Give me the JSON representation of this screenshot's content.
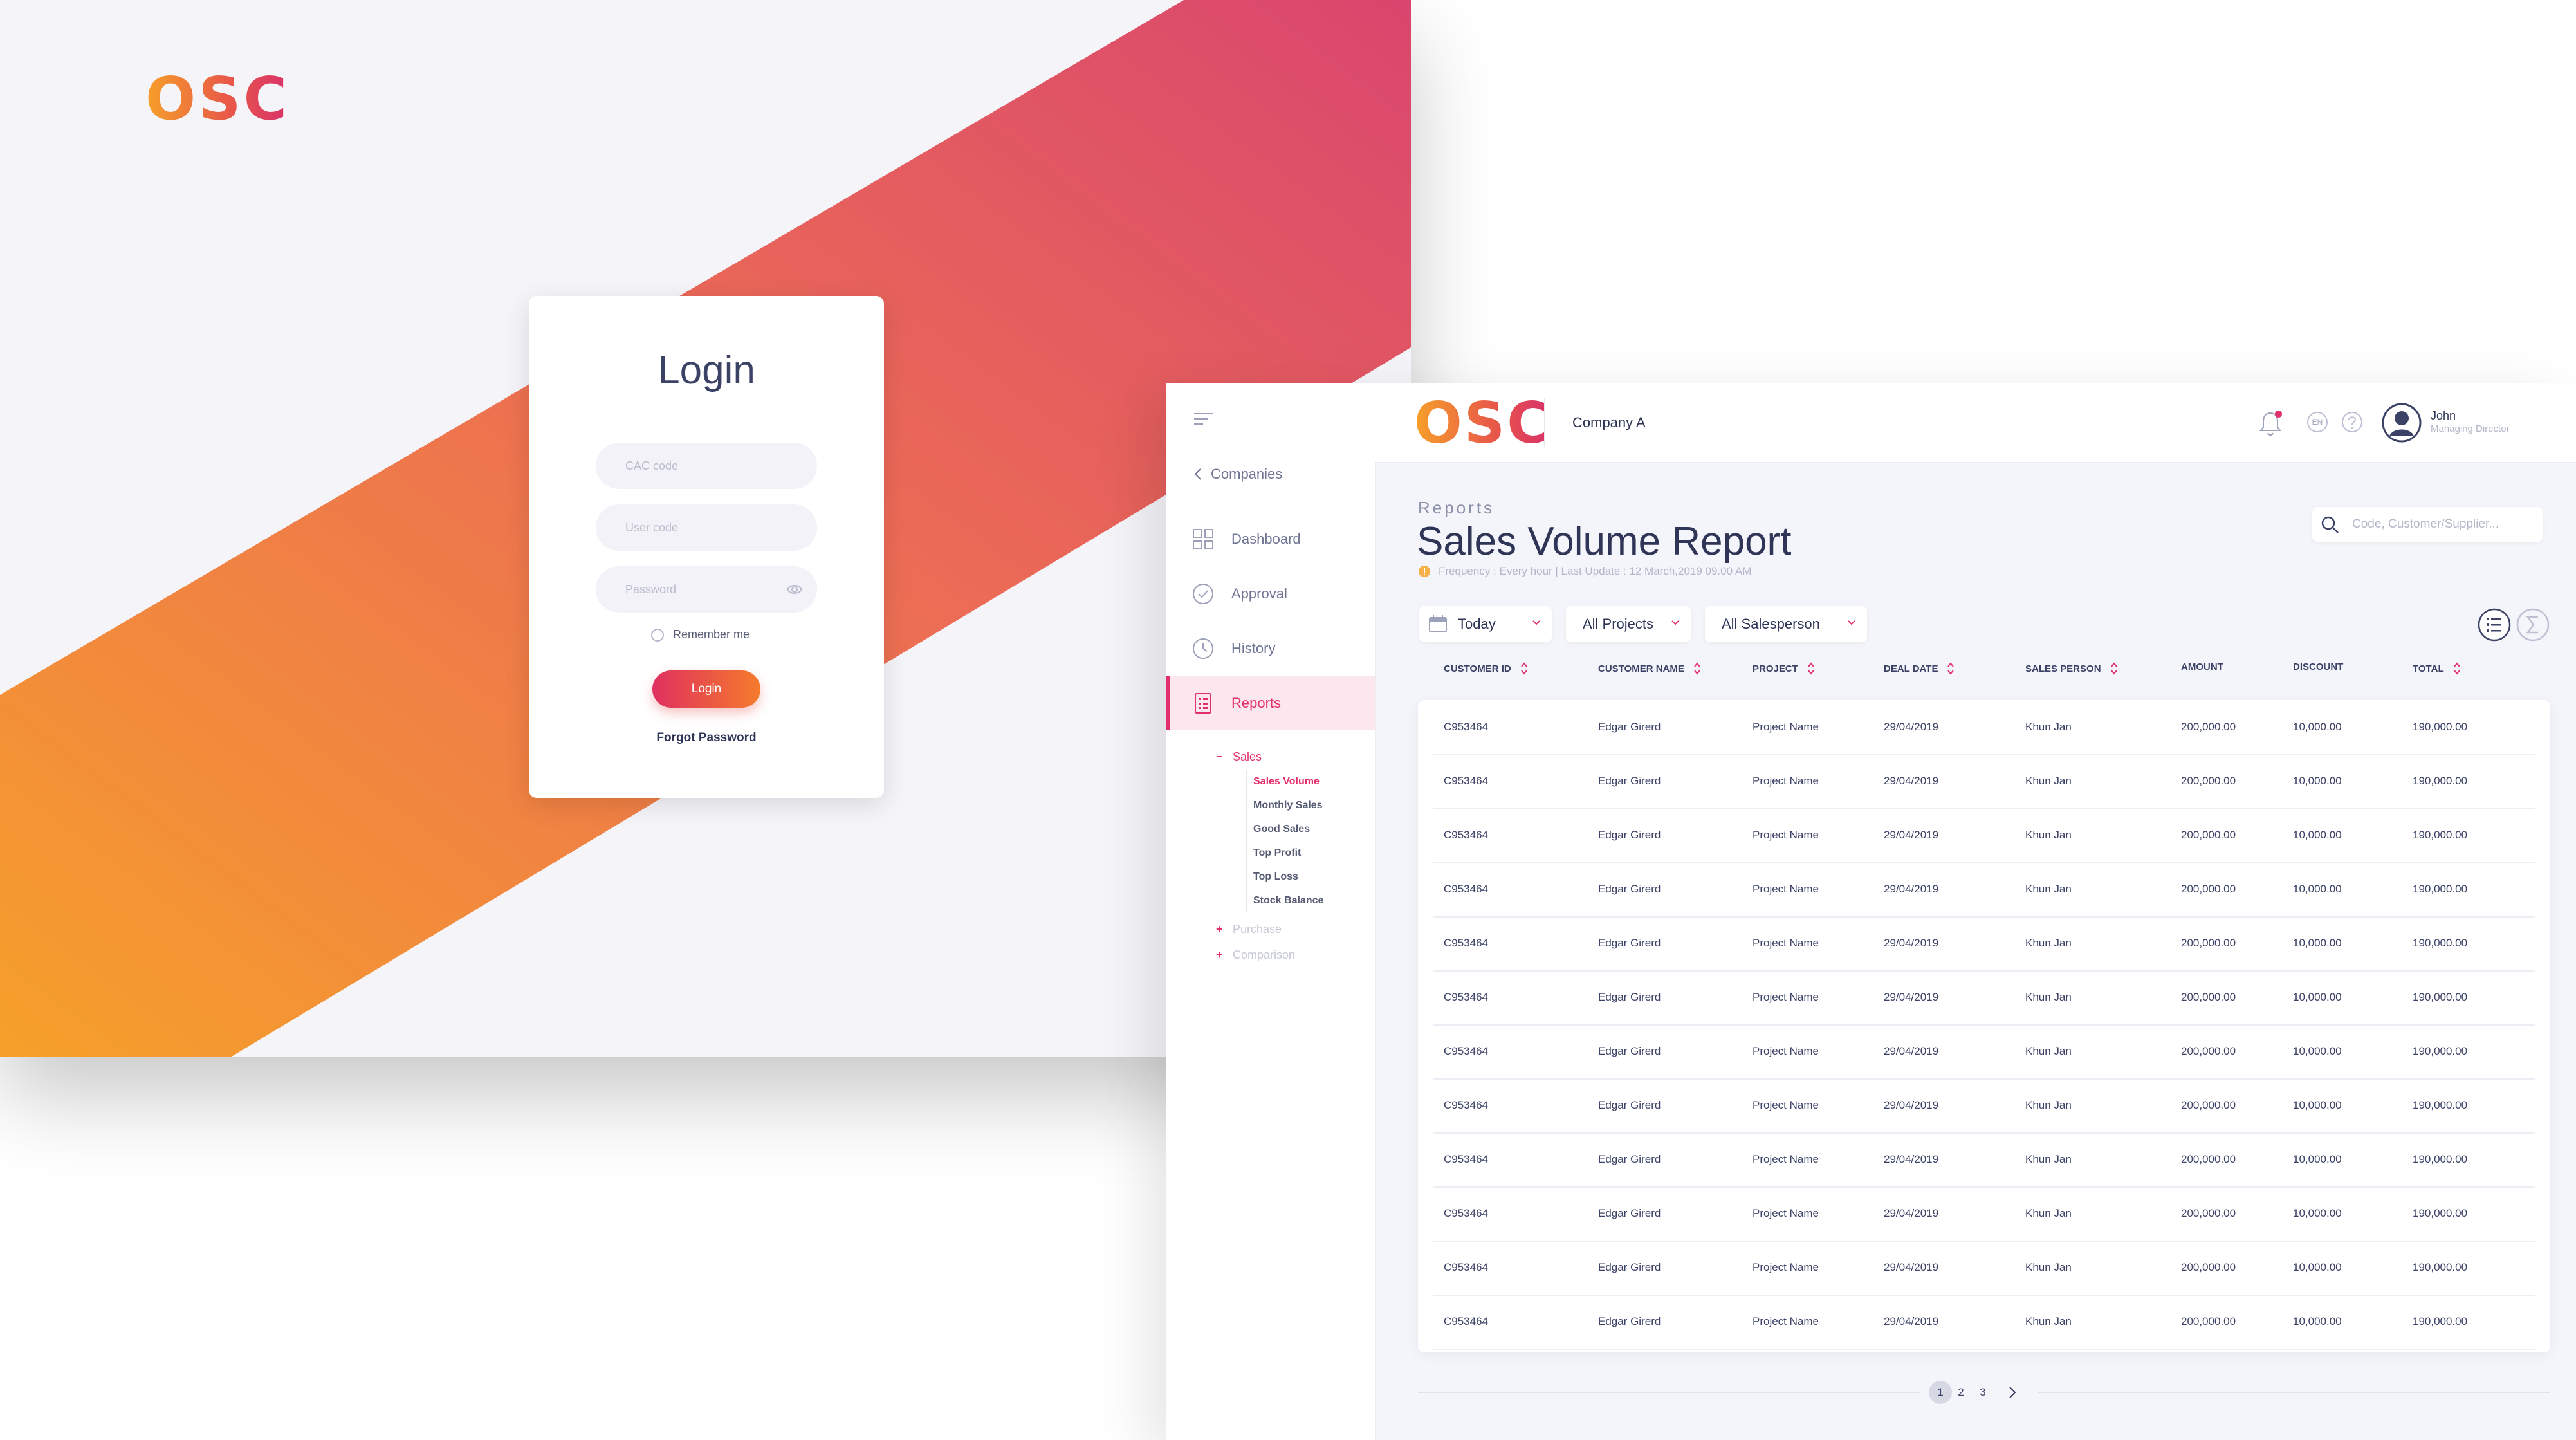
{
  "login": {
    "logo": "OSC",
    "title": "Login",
    "cac_placeholder": "CAC code",
    "user_placeholder": "User  code",
    "password_placeholder": "Password",
    "remember_label": "Remember me",
    "login_button": "Login",
    "forgot_password": "Forgot Password",
    "colors": {
      "gradient_start": "#f6a02a",
      "gradient_mid": "#e8564a",
      "gradient_end": "#d8316a"
    }
  },
  "app": {
    "logo": "OSC",
    "company": "Company A",
    "language": "EN",
    "user": {
      "name": "John",
      "role": "Managing Director"
    },
    "icons": [
      "menu-icon",
      "bell-icon",
      "help-icon",
      "avatar-icon"
    ]
  },
  "sidebar": {
    "back_label": "Companies",
    "items": [
      {
        "label": "Dashboard",
        "icon": "grid-icon"
      },
      {
        "label": "Approval",
        "icon": "check-circle-icon"
      },
      {
        "label": "History",
        "icon": "clock-icon"
      },
      {
        "label": "Reports",
        "icon": "report-icon",
        "active": true
      }
    ],
    "sub": {
      "sales": {
        "label": "Sales",
        "items": [
          "Sales Volume",
          "Monthly Sales",
          "Good Sales",
          "Top Profit",
          "Top Loss",
          "Stock Balance"
        ]
      },
      "purchase": "Purchase",
      "comparison": "Comparison"
    }
  },
  "report": {
    "breadcrumb": "Reports",
    "title": "Sales Volume Report",
    "frequency": "Frequency : Every hour | Last Update : 12 March,2019 09.00 AM",
    "search_placeholder": "Code, Customer/Supplier...",
    "filters": {
      "date": "Today",
      "projects": "All Projects",
      "salesperson": "All Salesperson"
    },
    "columns": [
      "CUSTOMER ID",
      "CUSTOMER NAME",
      "PROJECT",
      "DEAL DATE",
      "SALES PERSON",
      "AMOUNT",
      "DISCOUNT",
      "TOTAL"
    ],
    "rows": [
      [
        "C953464",
        "Edgar Girerd",
        "Project Name",
        "29/04/2019",
        "Khun Jan",
        "200,000.00",
        "10,000.00",
        "190,000.00"
      ],
      [
        "C953464",
        "Edgar Girerd",
        "Project Name",
        "29/04/2019",
        "Khun Jan",
        "200,000.00",
        "10,000.00",
        "190,000.00"
      ],
      [
        "C953464",
        "Edgar Girerd",
        "Project Name",
        "29/04/2019",
        "Khun Jan",
        "200,000.00",
        "10,000.00",
        "190,000.00"
      ],
      [
        "C953464",
        "Edgar Girerd",
        "Project Name",
        "29/04/2019",
        "Khun Jan",
        "200,000.00",
        "10,000.00",
        "190,000.00"
      ],
      [
        "C953464",
        "Edgar Girerd",
        "Project Name",
        "29/04/2019",
        "Khun Jan",
        "200,000.00",
        "10,000.00",
        "190,000.00"
      ],
      [
        "C953464",
        "Edgar Girerd",
        "Project Name",
        "29/04/2019",
        "Khun Jan",
        "200,000.00",
        "10,000.00",
        "190,000.00"
      ],
      [
        "C953464",
        "Edgar Girerd",
        "Project Name",
        "29/04/2019",
        "Khun Jan",
        "200,000.00",
        "10,000.00",
        "190,000.00"
      ],
      [
        "C953464",
        "Edgar Girerd",
        "Project Name",
        "29/04/2019",
        "Khun Jan",
        "200,000.00",
        "10,000.00",
        "190,000.00"
      ],
      [
        "C953464",
        "Edgar Girerd",
        "Project Name",
        "29/04/2019",
        "Khun Jan",
        "200,000.00",
        "10,000.00",
        "190,000.00"
      ],
      [
        "C953464",
        "Edgar Girerd",
        "Project Name",
        "29/04/2019",
        "Khun Jan",
        "200,000.00",
        "10,000.00",
        "190,000.00"
      ],
      [
        "C953464",
        "Edgar Girerd",
        "Project Name",
        "29/04/2019",
        "Khun Jan",
        "200,000.00",
        "10,000.00",
        "190,000.00"
      ],
      [
        "C953464",
        "Edgar Girerd",
        "Project Name",
        "29/04/2019",
        "Khun Jan",
        "200,000.00",
        "10,000.00",
        "190,000.00"
      ]
    ],
    "pages": [
      "1",
      "2",
      "3"
    ],
    "current_page": "1",
    "colors": {
      "accent": "#e2306c",
      "text": "#2f3556",
      "muted": "#b2b6c8"
    }
  }
}
